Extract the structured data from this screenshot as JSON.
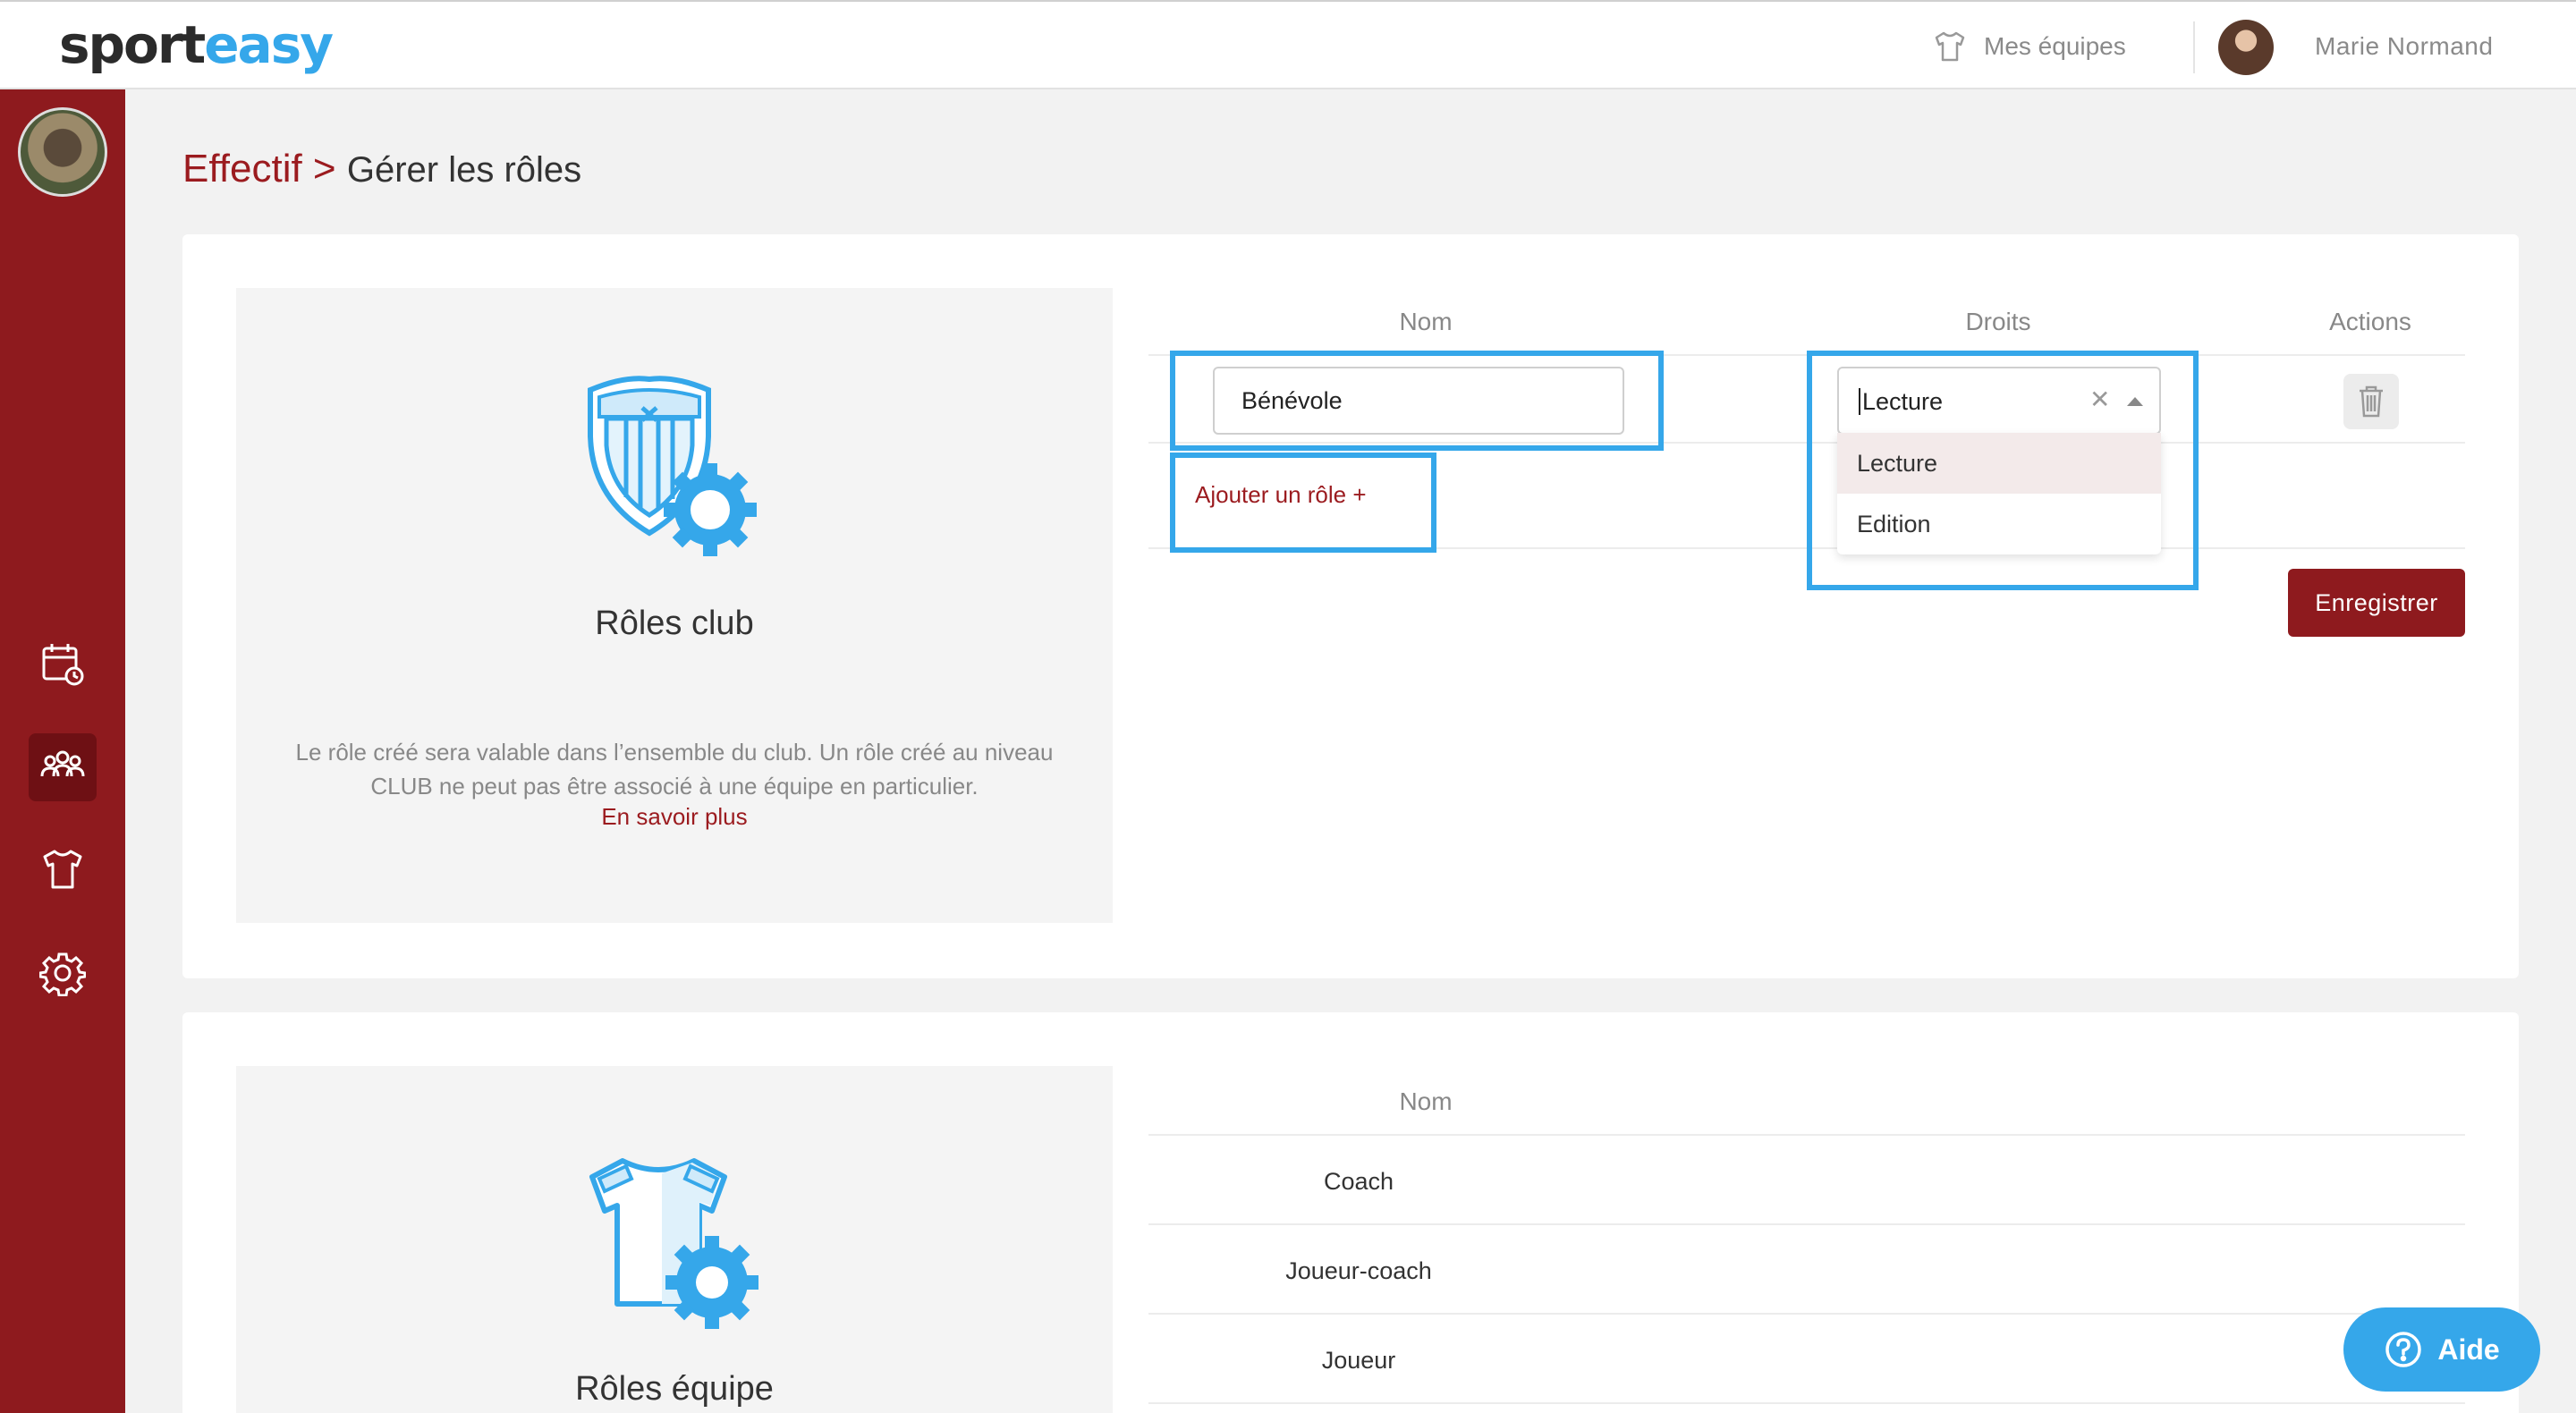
{
  "header": {
    "logo_part1": "sport",
    "logo_part2": "easy",
    "teams_label": "Mes équipes",
    "user_name": "Marie Normand"
  },
  "breadcrumb": {
    "section": "Effectif >",
    "page": "Gérer les rôles"
  },
  "club_roles": {
    "title": "Rôles club",
    "description": "Le rôle créé sera valable dans l’ensemble du club. Un rôle créé au niveau CLUB ne peut pas être associé à une équipe en particulier.",
    "learn_more": "En savoir plus",
    "columns": {
      "name": "Nom",
      "rights": "Droits",
      "actions": "Actions"
    },
    "row": {
      "name_value": "Bénévole",
      "rights_value": "Lecture"
    },
    "rights_options": [
      "Lecture",
      "Edition"
    ],
    "add_role": "Ajouter un rôle +",
    "save_label": "Enregistrer"
  },
  "team_roles": {
    "title": "Rôles équipe",
    "columns": {
      "name": "Nom"
    },
    "rows": [
      "Coach",
      "Joueur-coach",
      "Joueur"
    ]
  },
  "help": {
    "label": "Aide"
  },
  "colors": {
    "brand_red": "#8e1a1e",
    "accent_blue": "#35a7ea"
  }
}
